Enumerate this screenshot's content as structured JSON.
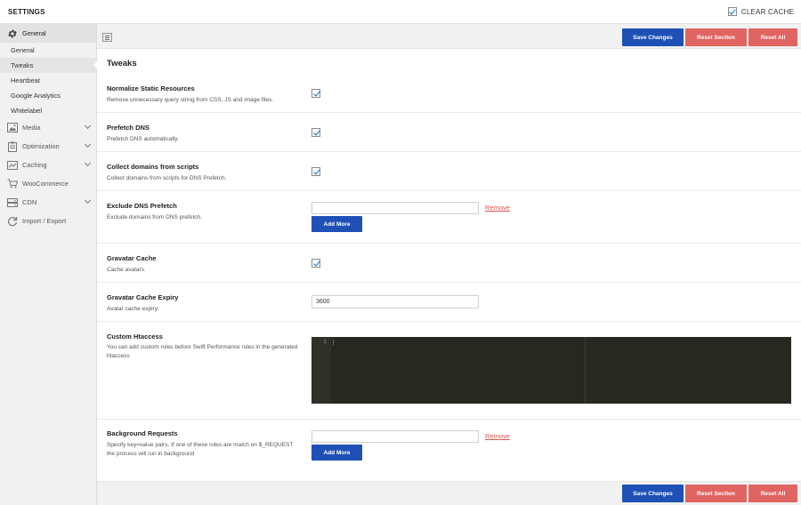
{
  "header": {
    "title": "SETTINGS",
    "clear_cache_label": "CLEAR CACHE",
    "clear_cache_checked": true
  },
  "sidebar": {
    "items": [
      {
        "label": "General",
        "icon": "gear-icon",
        "active": true
      },
      {
        "label": "Media",
        "icon": "image-icon",
        "expandable": true
      },
      {
        "label": "Optimization",
        "icon": "clipboard-icon",
        "expandable": true
      },
      {
        "label": "Caching",
        "icon": "caching-icon",
        "expandable": true
      },
      {
        "label": "WooCommerce",
        "icon": "cart-icon"
      },
      {
        "label": "CDN",
        "icon": "cdn-icon",
        "expandable": true
      },
      {
        "label": "Import / Export",
        "icon": "refresh-icon"
      }
    ],
    "subitems": [
      {
        "label": "General"
      },
      {
        "label": "Tweaks",
        "current": true
      },
      {
        "label": "Heartbeat"
      },
      {
        "label": "Google Analytics"
      },
      {
        "label": "Whitelabel"
      }
    ]
  },
  "toolbar": {
    "save_label": "Save Changes",
    "reset_section_label": "Reset Section",
    "reset_all_label": "Reset All"
  },
  "section": {
    "title": "Tweaks"
  },
  "settings": [
    {
      "title": "Normalize Static Resources",
      "desc": "Remove unnecessary query string from CSS, JS and image files.",
      "type": "checkbox",
      "checked": true
    },
    {
      "title": "Prefetch DNS",
      "desc": "Prefetch DNS automatically.",
      "type": "checkbox",
      "checked": true
    },
    {
      "title": "Collect domains from scripts",
      "desc": "Collect domains from scripts for DNS Prefetch.",
      "type": "checkbox",
      "checked": true
    },
    {
      "title": "Exclude DNS Prefetch",
      "desc": "Exclude domains from DNS prefetch.",
      "type": "repeater",
      "value": "",
      "remove_label": "Remove",
      "add_label": "Add More"
    },
    {
      "title": "Gravatar Cache",
      "desc": "Cache avatars.",
      "type": "checkbox",
      "checked": true
    },
    {
      "title": "Gravatar Cache Expiry",
      "desc": "Avatar cache expiry.",
      "type": "text",
      "value": "3600"
    },
    {
      "title": "Custom Htaccess",
      "desc": "You can add custom rules before Swift Performance rules in the generated htaccess",
      "type": "code",
      "line_number": "1"
    },
    {
      "title": "Background Requests",
      "desc": "Specify key=value pairs. If one of these rules are match on $_REQUEST the process will run in background",
      "type": "repeater",
      "value": "",
      "remove_label": "Remove",
      "add_label": "Add More"
    }
  ],
  "colors": {
    "primary": "#1f50b6",
    "danger": "#e06461",
    "link_danger": "#d9534f",
    "editor_bg": "#272822"
  }
}
